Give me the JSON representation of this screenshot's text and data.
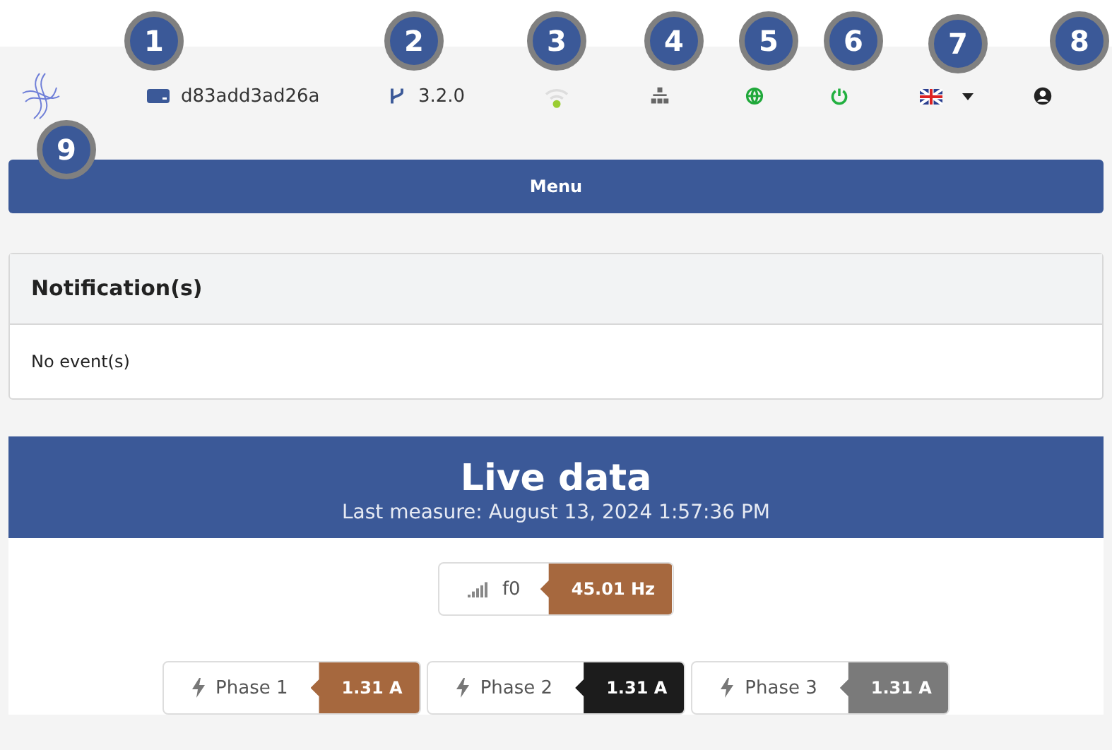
{
  "callouts": [
    "1",
    "2",
    "3",
    "4",
    "5",
    "6",
    "7",
    "8",
    "9"
  ],
  "header": {
    "device_id": "d83add3ad26a",
    "version": "3.2.0"
  },
  "menu": {
    "label": "Menu"
  },
  "notifications": {
    "title": "Notification(s)",
    "body": "No event(s)"
  },
  "live_data": {
    "title": "Live data",
    "subtitle": "Last measure: August 13, 2024 1:57:36 PM",
    "frequency": {
      "label": "f0",
      "value": "45.01 Hz",
      "color": "#a6683e"
    },
    "phases": [
      {
        "label": "Phase 1",
        "value": "1.31 A",
        "color": "#a6683e"
      },
      {
        "label": "Phase 2",
        "value": "1.31 A",
        "color": "#1c1c1c"
      },
      {
        "label": "Phase 3",
        "value": "1.31 A",
        "color": "#7a7a7a"
      }
    ]
  }
}
